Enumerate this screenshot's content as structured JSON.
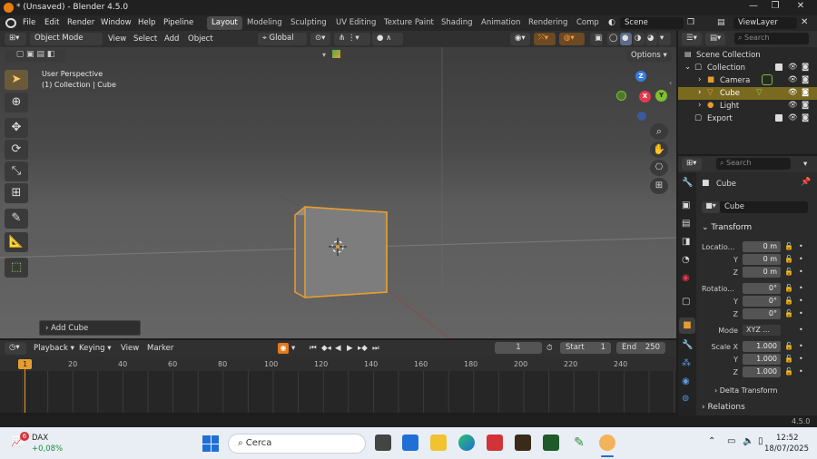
{
  "window": {
    "title": "* (Unsaved) - Blender 4.5.0"
  },
  "menu": [
    "File",
    "Edit",
    "Render",
    "Window",
    "Help",
    "Pipeline"
  ],
  "workspaces": [
    "Layout",
    "Modeling",
    "Sculpting",
    "UV Editing",
    "Texture Paint",
    "Shading",
    "Animation",
    "Rendering",
    "Compo"
  ],
  "scene": {
    "name": "Scene",
    "view_layer": "ViewLayer"
  },
  "viewport_header": {
    "mode": "Object Mode",
    "menus": [
      "View",
      "Select",
      "Add",
      "Object"
    ],
    "orientation": "Global",
    "options": "Options"
  },
  "viewport": {
    "perspective": "User Perspective",
    "context": "(1) Collection | Cube",
    "gizmo": {
      "z": "Z",
      "x": "X",
      "y": "Y"
    },
    "operator_panel": "Add Cube"
  },
  "timeline": {
    "menus": [
      "Playback",
      "Keying",
      "View",
      "Marker"
    ],
    "current_frame": "1",
    "start_label": "Start",
    "start": "1",
    "end_label": "End",
    "end": "250",
    "frame_marker": "1",
    "ticks": [
      "20",
      "40",
      "60",
      "80",
      "100",
      "120",
      "140",
      "160",
      "180",
      "200",
      "220",
      "240"
    ]
  },
  "outliner": {
    "search_placeholder": "Search",
    "root": "Scene Collection",
    "items": [
      {
        "name": "Collection"
      },
      {
        "name": "Camera"
      },
      {
        "name": "Cube"
      },
      {
        "name": "Light"
      },
      {
        "name": "Export"
      }
    ]
  },
  "properties": {
    "search_placeholder": "Search",
    "object_name": "Cube",
    "datablock": "Cube",
    "transform_title": "Transform",
    "location_label": "Locatio...",
    "location": [
      "0 m",
      "0 m",
      "0 m"
    ],
    "rotation_label": "Rotatio...",
    "rotation": [
      "0°",
      "0°",
      "0°"
    ],
    "mode_label": "Mode",
    "mode": "XYZ ...",
    "scale_label": "Scale X",
    "scale": [
      "1.000",
      "1.000",
      "1.000"
    ],
    "axis_y": "Y",
    "axis_z": "Z",
    "delta": "Delta Transform",
    "relations": "Relations"
  },
  "status": {
    "version": "4.5.0"
  },
  "taskbar": {
    "stock_name": "DAX",
    "stock_change": "+0,08%",
    "badge": "6",
    "search": "Cerca",
    "time": "12:52",
    "date": "18/07/2025"
  },
  "colors": {
    "accent": "#e59d2e",
    "selection": "#7a6a20",
    "active_workspace": "#4a4a4a",
    "gizmo_x": "#e23a4e",
    "gizmo_y": "#7fbf2f",
    "gizmo_z": "#3a7de2"
  }
}
